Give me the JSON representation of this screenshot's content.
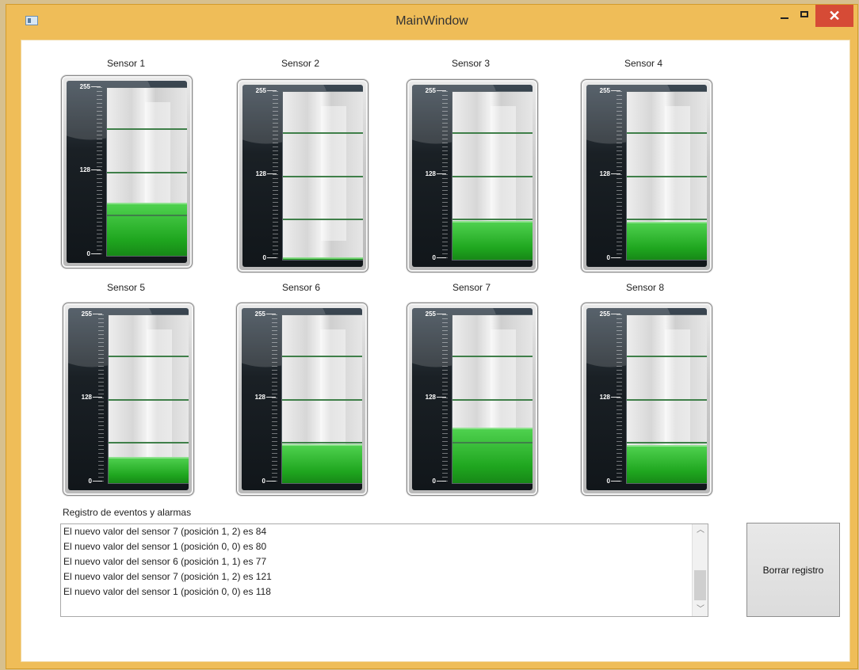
{
  "window": {
    "title": "MainWindow",
    "close_symbol": "✕"
  },
  "sensors": [
    {
      "label": "Sensor 1",
      "value": 80
    },
    {
      "label": "Sensor 2",
      "value": 4
    },
    {
      "label": "Sensor 3",
      "value": 58
    },
    {
      "label": "Sensor 4",
      "value": 57
    },
    {
      "label": "Sensor 5",
      "value": 39
    },
    {
      "label": "Sensor 6",
      "value": 58
    },
    {
      "label": "Sensor 7",
      "value": 84
    },
    {
      "label": "Sensor 8",
      "value": 57
    }
  ],
  "gauge_scale": {
    "max": "255",
    "mid": "128",
    "min": "0"
  },
  "log": {
    "title": "Registro de eventos y alarmas",
    "entries": [
      "El nuevo valor del sensor 7 (posición 1, 2) es 84",
      "El nuevo valor del sensor 1 (posición 0, 0) es 80",
      "El nuevo valor del sensor 6 (posición 1, 1) es 77",
      "El nuevo valor del sensor 7 (posición 1, 2) es 121",
      "El nuevo valor del sensor 1 (posición 0, 0) es 118"
    ]
  },
  "buttons": {
    "clear_log": "Borrar registro"
  },
  "icons": {
    "app": "app-icon",
    "minimize": "minimize-icon",
    "maximize": "maximize-icon",
    "close": "close-icon",
    "scroll_up": "chevron-up-icon",
    "scroll_down": "chevron-down-icon"
  },
  "colors": {
    "titlebar": "#efbd58",
    "close": "#d64b36",
    "gauge_fill": "#2fbf2f"
  }
}
